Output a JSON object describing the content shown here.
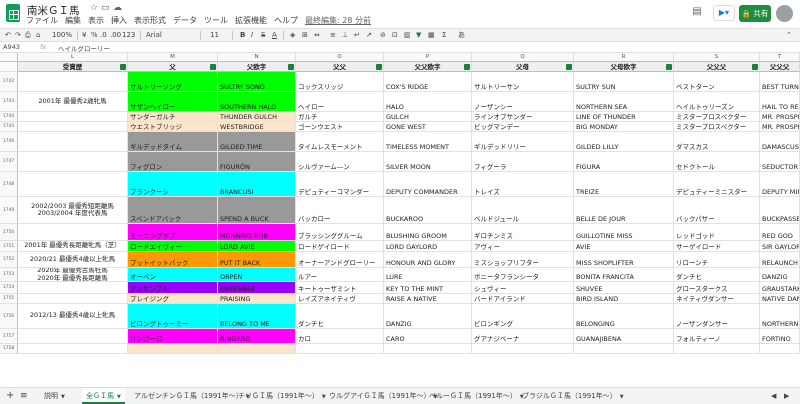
{
  "window": {
    "doc_title": "南米ＧＩ馬",
    "star_icon": "star-icon",
    "move_icon": "folder-icon",
    "cloud_icon": "cloud-icon",
    "menu": [
      "ファイル",
      "編集",
      "表示",
      "挿入",
      "表示形式",
      "データ",
      "ツール",
      "拡張機能",
      "ヘルプ"
    ],
    "last_edit": "最終編集: 28 分前",
    "comment_icon": "comment-icon",
    "present_icon": "present-icon",
    "share_label": "共有"
  },
  "toolbar": {
    "zoom": "100%",
    "currency": "¥",
    "percent": "%",
    "decimal_dec": ".0",
    "decimal_inc": ".00",
    "number_format": "123",
    "font": "Arial",
    "font_size": "11",
    "bold": "B",
    "italic": "I",
    "strike": "S",
    "text_color": "A"
  },
  "formula_bar": {
    "cell_ref": "A943",
    "fx": "fx",
    "value": "ヘイルグローリー"
  },
  "columns": [
    "L",
    "M",
    "N",
    "O",
    "P",
    "Q",
    "R",
    "S",
    "T"
  ],
  "headers": [
    "受賞歴",
    "父",
    "父欧字",
    "父父",
    "父父欧字",
    "父母",
    "父母欧字",
    "父父父",
    "父父父"
  ],
  "rows": [
    {
      "num": "1742",
      "cells": [
        "",
        "サルトリーソング",
        "SULTRY SONG",
        "コックスリッジ",
        "COX'S RIDGE",
        "サルトリーサン",
        "SULTRY SUN",
        "ベストターン",
        "BEST TURN"
      ]
    },
    {
      "num": "1743",
      "cells": [
        "2001年 最優秀2歳牝馬",
        "サザンヘイロー",
        "SOUTHERN HALO",
        "ヘイロー",
        "HALO",
        "ノーザンシー",
        "NORTHERN SEA",
        "ヘイルトゥリーズン",
        "HAIL TO REASON"
      ]
    },
    {
      "num": "1744",
      "cells": [
        "",
        "サンダーガルチ",
        "THUNDER GULCH",
        "ガルチ",
        "GULCH",
        "ラインオブサンダー",
        "LINE OF THUNDER",
        "ミスタープロスペクター",
        "MR. PROSPECTOR"
      ]
    },
    {
      "num": "1745",
      "cells": [
        "",
        "ウエストブリッジ",
        "WESTBRIDGE",
        "ゴーンウエスト",
        "GONE WEST",
        "ビッグマンデー",
        "BIG MONDAY",
        "ミスタープロスペクター",
        "MR. PROSPECTOR"
      ]
    },
    {
      "num": "1746",
      "cells": [
        "",
        "ギルデッドタイム",
        "GILDED TIME",
        "タイムレスモーメント",
        "TIMELESS MOMENT",
        "ギルデッドリリー",
        "GILDED LILLY",
        "ダマスカス",
        "DAMASCUS"
      ]
    },
    {
      "num": "1747",
      "cells": [
        "",
        "フィグロン",
        "FIGURÓN",
        "シルヴァーム―ン",
        "SILVER MOON",
        "フィグーラ",
        "FIGURA",
        "セドクトール",
        "SEDUCTOR"
      ]
    },
    {
      "num": "1748",
      "cells": [
        "",
        "ブランクーシ",
        "BRANCUSI",
        "デピュティーコマンダー",
        "DEPUTY COMMANDER",
        "トレイズ",
        "TREIZE",
        "デピュティーミニスター",
        "DEPUTY MINISTER"
      ]
    },
    {
      "num": "1749",
      "cells": [
        "2002/2003 最優秀短距離馬\n2003/2004 年度代表馬",
        "スペンドアバック",
        "SPEND A BUCK",
        "バッカロー",
        "BUCKAROO",
        "ベルドジュール",
        "BELLE DE JOUR",
        "バックパサー",
        "BUCKPASSER"
      ]
    },
    {
      "num": "1750",
      "cells": [
        "",
        "モーニングボブ",
        "MORNING BOB",
        "ブラッシンググルーム",
        "BLUSHING GROOM",
        "ギロチンミス",
        "GUILLOTINE MISS",
        "レッドゴッド",
        "RED GOD"
      ]
    },
    {
      "num": "1751",
      "cells": [
        "2001年 最優秀長距離牝馬（芝）",
        "ロードエイヴィー",
        "LORD AVIE",
        "ロードゲイロード",
        "LORD GAYLORD",
        "アヴィー",
        "AVIE",
        "サーゲイロード",
        "SIR GAYLORD"
      ]
    },
    {
      "num": "1752",
      "cells": [
        "2020/21 最優秀4歳以上牝馬",
        "プットイットバック",
        "PUT IT BACK",
        "オーナーアンドグローリー",
        "HONOUR AND GLORY",
        "ミスショップリフター",
        "MISS SHOPLIFTER",
        "リローンチ",
        "RELAUNCH"
      ]
    },
    {
      "num": "1753",
      "cells": [
        "2020年 最優秀古馬牡馬\n2020年 最優秀長距離馬",
        "オーペン",
        "ORPEN",
        "ルアー",
        "LURE",
        "ボニータフランシータ",
        "BONITA FRANCITA",
        "ダンチヒ",
        "DANZIG"
      ]
    },
    {
      "num": "1754",
      "cells": [
        "",
        "アンサンブル",
        "ENSEMBLE",
        "キートゥーザミント",
        "KEY TO THE MINT",
        "シュヴィー",
        "SHUVEE",
        "グロースタークス",
        "GRAUSTARK"
      ]
    },
    {
      "num": "1755",
      "cells": [
        "",
        "プレイジング",
        "PRAISING",
        "レイズアネイティヴ",
        "RAISE A NATIVE",
        "バードアイランド",
        "BIRD ISLAND",
        "ネイティヴダンサー",
        "NATIVE DANCER"
      ]
    },
    {
      "num": "1756",
      "cells": [
        "2012/13 最優秀4歳以上牝馬",
        "ビロングトゥーミー",
        "BELONG TO ME",
        "ダンチヒ",
        "DANZIG",
        "ビロンギング",
        "BELONGING",
        "ノーザンダンサー",
        "NORTHERN DANCER"
      ]
    },
    {
      "num": "1757",
      "cells": [
        "",
        "リンガーロ",
        "RINGARO",
        "カロ",
        "CARO",
        "グアナジベーナ",
        "GUANAJIBENA",
        "フォルティーノ",
        "FORTINO"
      ]
    },
    {
      "num": "1758",
      "cells": [
        "",
        "",
        "",
        "",
        "",
        "",
        "",
        "",
        ""
      ]
    }
  ],
  "sheet_tabs": [
    {
      "label": "説明",
      "active": false
    },
    {
      "label": "全ＧＩ馬",
      "active": true
    },
    {
      "label": "アルゼンチンＧＩ馬（1991年～）",
      "active": false
    },
    {
      "label": "チリＧＩ馬（1991年～）",
      "active": false
    },
    {
      "label": "ウルグアイＧＩ馬（1991年～）",
      "active": false
    },
    {
      "label": "ペルーＧＩ馬（1991年～）",
      "active": false
    },
    {
      "label": "ブラジルＧＩ馬（1991年～）",
      "active": false
    }
  ],
  "colors": {
    "green": "#00ff00",
    "peach": "#fce5cd",
    "gray": "#999999",
    "cyan": "#00ffff",
    "magenta": "#ff00ff",
    "orange": "#ff9900",
    "purple": "#9900ff",
    "sheets_green": "#188038"
  }
}
